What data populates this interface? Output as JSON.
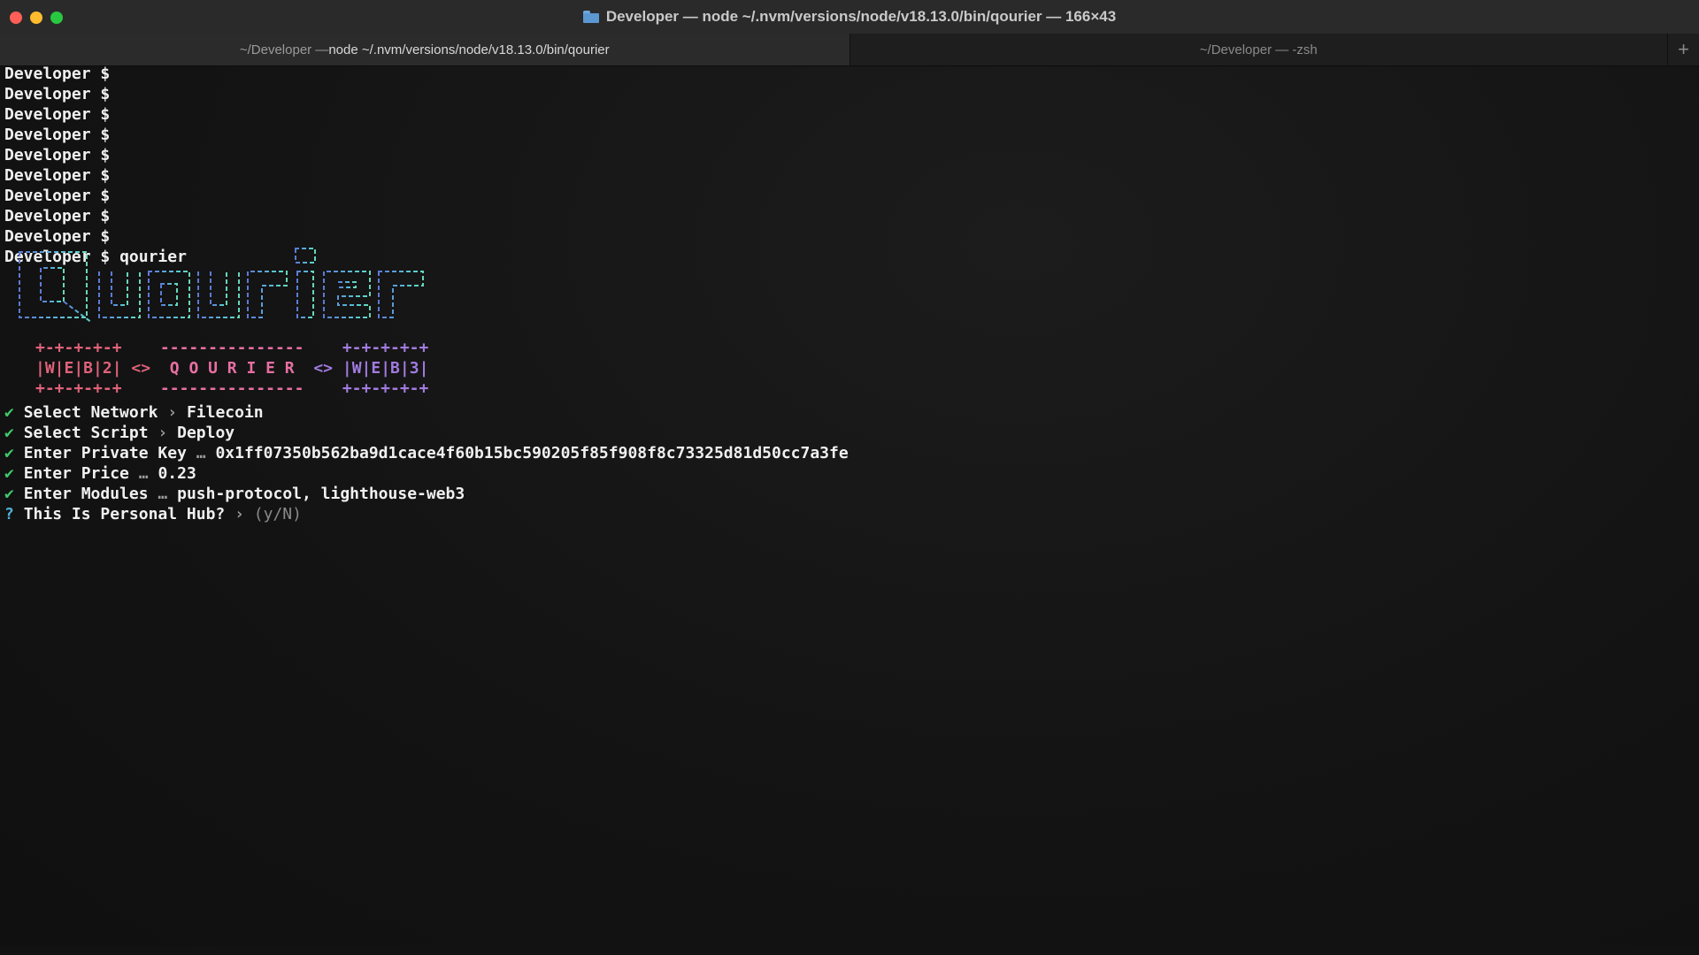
{
  "window": {
    "title": "Developer — node ~/.nvm/versions/node/v18.13.0/bin/qourier — 166×43",
    "traffic_colors": {
      "close": "#ff5f57",
      "minimize": "#febc2e",
      "zoom": "#28c840"
    }
  },
  "tabs": [
    {
      "prefix": "~/Developer — ",
      "label": "node ~/.nvm/versions/node/v18.13.0/bin/qourier",
      "active": true
    },
    {
      "prefix": "",
      "label": "~/Developer — -zsh",
      "active": false
    }
  ],
  "tab_add_label": "+",
  "prompt_lines": [
    "Developer $",
    "Developer $",
    "Developer $",
    "Developer $",
    "Developer $",
    "Developer $",
    "Developer $",
    "Developer $",
    "Developer $"
  ],
  "command_line": {
    "prompt": "Developer $",
    "command": "qourier"
  },
  "ascii_logo_colors": [
    "#5b7bd5",
    "#5aa8d8",
    "#57d0d0",
    "#68d6b8"
  ],
  "banner": {
    "web2_border": "+-+-+-+-+",
    "web2_text": "|W|E|B|2|",
    "arrow": "<>",
    "qourier_rule": "---------------",
    "qourier_text": "Q O U R I E R",
    "web3_border": "+-+-+-+-+",
    "web3_text": "|W|E|B|3|"
  },
  "prompts": [
    {
      "status": "✔",
      "label": "Select Network",
      "sep": "›",
      "value": "Filecoin"
    },
    {
      "status": "✔",
      "label": "Select Script",
      "sep": "›",
      "value": "Deploy"
    },
    {
      "status": "✔",
      "label": "Enter Private Key",
      "sep": "…",
      "value": "0x1ff07350b562ba9d1cace4f60b15bc590205f85f908f8c73325d81d50cc7a3fe"
    },
    {
      "status": "✔",
      "label": "Enter Price",
      "sep": "…",
      "value": "0.23"
    },
    {
      "status": "✔",
      "label": "Enter Modules",
      "sep": "…",
      "value": "push-protocol, lighthouse-web3"
    }
  ],
  "question": {
    "status": "?",
    "label": "This Is Personal Hub?",
    "sep": "›",
    "hint": "(y/N)"
  }
}
